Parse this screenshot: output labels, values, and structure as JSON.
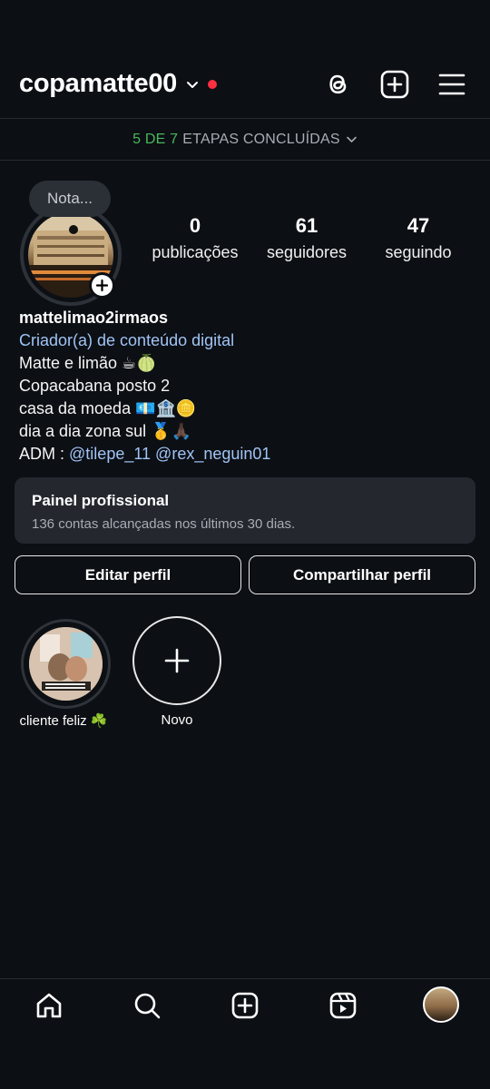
{
  "header": {
    "username": "copamatte00",
    "icons": [
      "chevron-down-icon",
      "threads-icon",
      "create-icon",
      "menu-icon"
    ],
    "status_dot_color": "#ff3040"
  },
  "steps": {
    "done": "5 DE 7",
    "rest": "ETAPAS CONCLUÍDAS",
    "done_color": "#4ab85b"
  },
  "profile": {
    "note_placeholder": "Nota...",
    "stats": [
      {
        "value": "0",
        "label": "publicações"
      },
      {
        "value": "61",
        "label": "seguidores"
      },
      {
        "value": "47",
        "label": "seguindo"
      }
    ]
  },
  "bio": {
    "name": "mattelimao2irmaos",
    "category": "Criador(a) de conteúdo digital",
    "lines": [
      "Matte e limão ☕🍈",
      "Copacabana posto 2",
      "casa da moeda 💶🏦🪙",
      "dia a dia zona sul 🥇🙏🏿"
    ],
    "adm_prefix": "ADM :",
    "mentions": [
      "@tilepe_11",
      "@rex_neguin01"
    ]
  },
  "panel": {
    "title": "Painel profissional",
    "subtitle": "136 contas alcançadas nos últimos 30 dias."
  },
  "buttons": {
    "edit": "Editar perfil",
    "share": "Compartilhar perfil"
  },
  "highlights": [
    {
      "label": "cliente feliz ☘️"
    },
    {
      "label": "Novo"
    }
  ],
  "nav": {
    "icons": [
      "home-icon",
      "search-icon",
      "create-icon",
      "reels-icon",
      "profile-avatar"
    ]
  },
  "colors": {
    "background": "#0c0f14",
    "link": "#a0c4f5",
    "panel": "#24272e"
  }
}
